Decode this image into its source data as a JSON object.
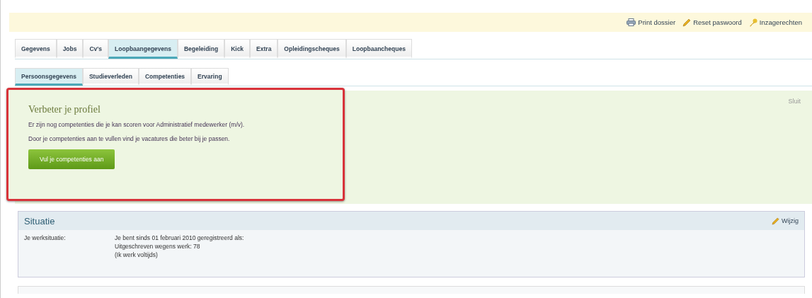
{
  "actions": [
    {
      "kind": "print",
      "label": "Print dossier"
    },
    {
      "kind": "pencil",
      "label": "Reset paswoord"
    },
    {
      "kind": "key",
      "label": "Inzagerechten"
    }
  ],
  "tabs": [
    {
      "label": "Gegevens",
      "selected": false
    },
    {
      "label": "Jobs",
      "selected": false
    },
    {
      "label": "Cv's",
      "selected": false
    },
    {
      "label": "Loopbaangegevens",
      "selected": true
    },
    {
      "label": "Begeleiding",
      "selected": false
    },
    {
      "label": "Kick",
      "selected": false
    },
    {
      "label": "Extra",
      "selected": false
    },
    {
      "label": "Opleidingscheques",
      "selected": false
    },
    {
      "label": "Loopbaancheques",
      "selected": false
    }
  ],
  "subtabs": [
    {
      "label": "Persoonsgegevens",
      "selected": true
    },
    {
      "label": "Studieverleden",
      "selected": false
    },
    {
      "label": "Competenties",
      "selected": false
    },
    {
      "label": "Ervaring",
      "selected": false
    }
  ],
  "notice": {
    "title": "Verbeter je profiel",
    "lines": [
      "Er zijn nog competenties die je kan scoren voor Administratief medewerker (m/v).",
      "Door je competenties aan te vullen vind je vacatures die beter bij je passen."
    ],
    "button": "Vul je competenties aan",
    "close": "Sluit"
  },
  "situation": {
    "title": "Situatie",
    "edit": "Wijzig",
    "label": "Je werksituatie:",
    "lines": [
      "Je bent sinds 01 februari 2010 geregistreerd als:",
      "Uitgeschreven wegens werk: 78",
      "(Ik werk voltijds)"
    ]
  }
}
